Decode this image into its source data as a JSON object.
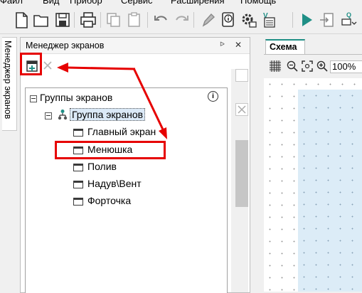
{
  "menu": [
    "Файл",
    "Вид",
    "Прибор",
    "Сервис",
    "Расширения",
    "Помощь"
  ],
  "side_tab": {
    "label": "Менеджер экранов"
  },
  "panel": {
    "title": "Менеджер экранов",
    "pin_glyph": "ᐅ",
    "close_glyph": "✕",
    "info_glyph": "i"
  },
  "tree": {
    "root": "Группы экранов",
    "group": "Группа экранов",
    "screens": [
      "Главный экран",
      "Менюшка",
      "Полив",
      "Надув\\Вент",
      "Форточка"
    ]
  },
  "scheme": {
    "tab_label": "Схема",
    "zoom": "100%"
  },
  "icons": {
    "toolbar": [
      "new-file-icon",
      "open-folder-icon",
      "save-icon",
      "print-icon",
      "copy-icon",
      "paste-icon",
      "undo-icon",
      "redo-icon",
      "pencil-icon",
      "info-doc-icon",
      "device-settings-icon",
      "verify-icon",
      "run-icon",
      "connect-icon",
      "device-search-icon"
    ],
    "panel_toolbar": [
      "add-screen-icon",
      "delete-icon"
    ]
  },
  "colors": {
    "annotation": "#e60000",
    "canvas": "#dcecf7",
    "accent": "#1f8f86"
  }
}
